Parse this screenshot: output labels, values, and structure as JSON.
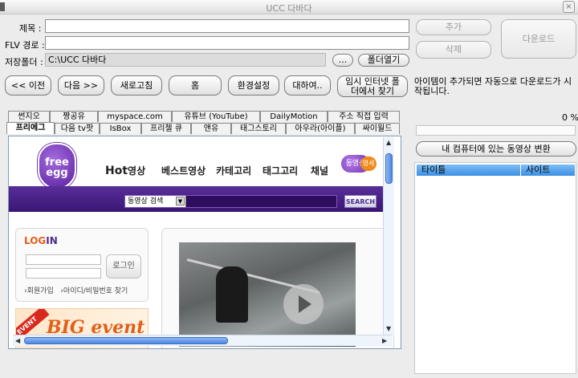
{
  "window": {
    "title": "UCC 다바다",
    "close": "×"
  },
  "form": {
    "title_label": "제목 :",
    "title_value": "",
    "flv_label": "FLV 경로 :",
    "flv_value": "",
    "folder_label": "저장폴더 :",
    "folder_value": "C:\\UCC 다바다",
    "browse_label": "...",
    "open_folder_label": "폴더열기"
  },
  "actions": {
    "add": "추가",
    "delete": "삭제",
    "download": "다운로드"
  },
  "nav": {
    "prev": "<< 이전",
    "next": "다음 >>",
    "refresh": "새로고침",
    "home": "홈",
    "settings": "환경설정",
    "about": "대하여..",
    "temp_folder": "임시 인터넷 폴더에서 찾기"
  },
  "notice": "아이템이 추가되면 자동으로 다운로드가 시작됩니다.",
  "progress": {
    "percent": "0 %",
    "value": 0
  },
  "convert_button": "내 컴퓨터에 있는 동영상 변환",
  "list_headers": [
    "타이틀",
    "사이트"
  ],
  "tabs_row1": [
    "썬지오",
    "짱공유",
    "myspace.com",
    "유튜브 (YouTube)",
    "DailyMotion",
    "주소 직접 입력"
  ],
  "tabs_row2": [
    "프리에그",
    "다음 tv팟",
    "IsBox",
    "프리첼 큐",
    "앤유",
    "태그스토리",
    "아우라(아이플)",
    "싸이월드"
  ],
  "webpage": {
    "logo_line1": "free",
    "logo_line2": "egg",
    "menu_hot": "Hot",
    "menu": [
      "영상",
      "베스트영상",
      "카테고리",
      "태그고리",
      "채널"
    ],
    "badge1": "동영상",
    "badge2": "영세",
    "search_select": "동영상 검색",
    "search_btn": "SEARCH",
    "login_title_a": "LOG",
    "login_title_b": "IN",
    "login_btn": "로그인",
    "join_link": "›회원가입",
    "find_link": "›아이디/비밀번호 찾기",
    "event_tag": "EVENT",
    "event_text": "BIG event"
  }
}
